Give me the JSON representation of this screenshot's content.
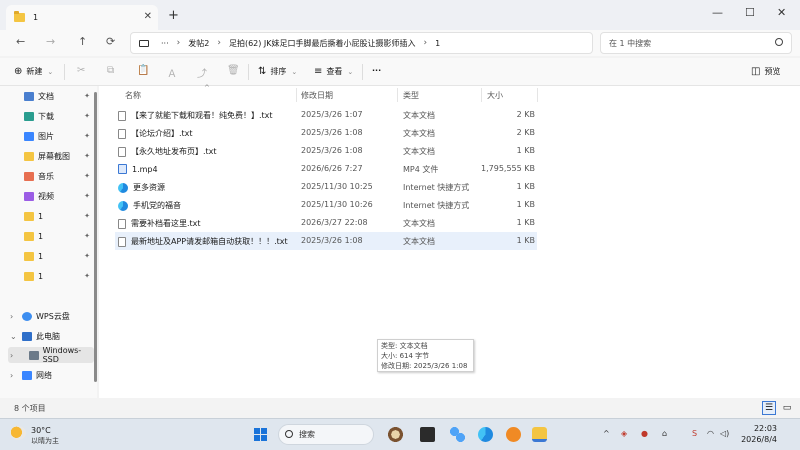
{
  "tab": {
    "title": "1",
    "close": "✕",
    "add": "+"
  },
  "window_controls": [
    "—",
    "☐",
    "✕"
  ],
  "nav": {
    "back": "←",
    "forward": "→",
    "up": "↑",
    "refresh": "⟳"
  },
  "address": {
    "more": "···",
    "crumbs": [
      "发帖2",
      "足拍(62) JK妹足口手脚最后撅着小屁股让摄影师插入",
      "1"
    ]
  },
  "search": {
    "placeholder": "在 1 中搜索"
  },
  "toolbar": {
    "new_label": "新建",
    "sort_label": "排序",
    "view_label": "查看",
    "more": "···",
    "preview_label": "预览"
  },
  "sidebar": {
    "quick": [
      {
        "label": "文档",
        "color": "#4a7fcf"
      },
      {
        "label": "下载",
        "color": "#2a9d8f"
      },
      {
        "label": "图片",
        "color": "#3a86ff"
      },
      {
        "label": "屏幕截图",
        "color": "#f4c542"
      },
      {
        "label": "音乐",
        "color": "#e76f51"
      },
      {
        "label": "视频",
        "color": "#9b5de5"
      },
      {
        "label": "1",
        "color": "#f4c542"
      },
      {
        "label": "1",
        "color": "#f4c542"
      },
      {
        "label": "1",
        "color": "#f4c542"
      },
      {
        "label": "1",
        "color": "#f4c542"
      }
    ],
    "wps": "WPS云盘",
    "this_pc": "此电脑",
    "drive": "Windows-SSD",
    "network": "网络"
  },
  "columns": {
    "name": "名称",
    "modified": "修改日期",
    "type": "类型",
    "size": "大小"
  },
  "files": [
    {
      "name": "【来了就能下载和观看！纯免费！】.txt",
      "modified": "2025/3/26 1:07",
      "type": "文本文档",
      "size": "2 KB",
      "icon": "txt"
    },
    {
      "name": "【论坛介绍】.txt",
      "modified": "2025/3/26 1:08",
      "type": "文本文档",
      "size": "2 KB",
      "icon": "txt"
    },
    {
      "name": "【永久地址发布页】.txt",
      "modified": "2025/3/26 1:08",
      "type": "文本文档",
      "size": "1 KB",
      "icon": "txt"
    },
    {
      "name": "1.mp4",
      "modified": "2026/6/26 7:27",
      "type": "MP4 文件",
      "size": "1,795,555 KB",
      "icon": "mp4"
    },
    {
      "name": "更多资源",
      "modified": "2025/11/30 10:25",
      "type": "Internet 快捷方式",
      "size": "1 KB",
      "icon": "url"
    },
    {
      "name": "手机党的福音",
      "modified": "2025/11/30 10:26",
      "type": "Internet 快捷方式",
      "size": "1 KB",
      "icon": "url"
    },
    {
      "name": "需要补档看这里.txt",
      "modified": "2026/3/27 22:08",
      "type": "文本文档",
      "size": "1 KB",
      "icon": "txt"
    },
    {
      "name": "最新地址及APP请发邮箱自动获取！！！.txt",
      "modified": "2025/3/26 1:08",
      "type": "文本文档",
      "size": "1 KB",
      "icon": "txt"
    }
  ],
  "tooltip": {
    "type": "类型: 文本文档",
    "size": "大小: 614 字节",
    "modified": "修改日期: 2025/3/26 1:08"
  },
  "status": {
    "count": "8 个项目"
  },
  "taskbar": {
    "temp": "30°C",
    "weather": "以晴为主",
    "search_label": "搜索",
    "time": "22:03",
    "date": "2026/8/4"
  }
}
